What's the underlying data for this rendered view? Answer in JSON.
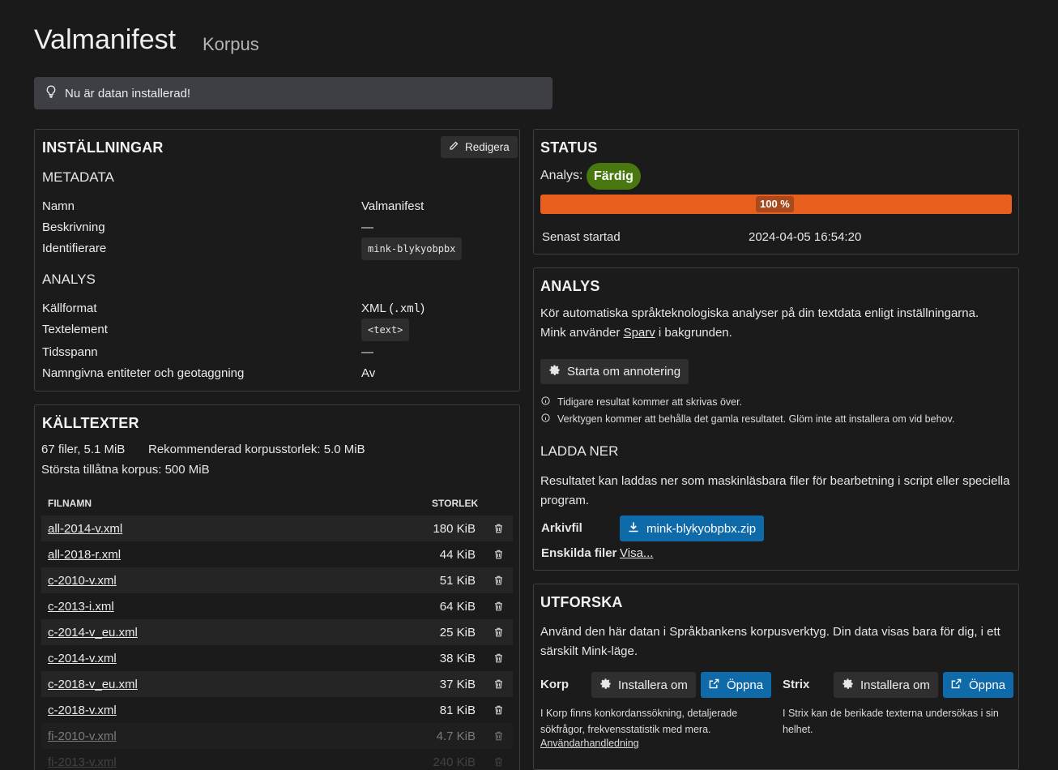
{
  "header": {
    "title": "Valmanifest",
    "subtitle": "Korpus"
  },
  "alert": {
    "text": "Nu är datan installerad!"
  },
  "settings": {
    "title": "INSTÄLLNINGAR",
    "edit_label": "Redigera",
    "metadata_title": "METADATA",
    "metadata": [
      {
        "label": "Namn",
        "value": "Valmanifest"
      },
      {
        "label": "Beskrivning",
        "value": "—"
      },
      {
        "label": "Identifierare",
        "value": "mink-blykyobpbx"
      }
    ],
    "analysis_title": "ANALYS",
    "analysis": [
      {
        "label": "Källformat",
        "value": "XML (",
        "value_code": ".xml",
        "value_suffix": ")"
      },
      {
        "label": "Textelement",
        "value": "<text>"
      },
      {
        "label": "Tidsspann",
        "value": "—"
      },
      {
        "label": "Namngivna entiteter och geotaggning",
        "value": "Av"
      }
    ]
  },
  "sources": {
    "title": "KÄLLTEXTER",
    "file_count": "67 filer, 5.1 MiB",
    "recommended": "Rekommenderad korpusstorlek: 5.0 MiB",
    "max": "Största tillåtna korpus: 500 MiB",
    "col_name": "FILNAMN",
    "col_size": "STORLEK",
    "files": [
      {
        "name": "all-2014-v.xml",
        "size": "180 KiB"
      },
      {
        "name": "all-2018-r.xml",
        "size": "44 KiB"
      },
      {
        "name": "c-2010-v.xml",
        "size": "51 KiB"
      },
      {
        "name": "c-2013-i.xml",
        "size": "64 KiB"
      },
      {
        "name": "c-2014-v_eu.xml",
        "size": "25 KiB"
      },
      {
        "name": "c-2014-v.xml",
        "size": "38 KiB"
      },
      {
        "name": "c-2018-v_eu.xml",
        "size": "37 KiB"
      },
      {
        "name": "c-2018-v.xml",
        "size": "81 KiB"
      },
      {
        "name": "fi-2010-v.xml",
        "size": "4.7 KiB"
      },
      {
        "name": "fi-2013-v.xml",
        "size": "240 KiB"
      }
    ]
  },
  "status": {
    "title": "STATUS",
    "analysis_label": "Analys:",
    "badge": "Färdig",
    "progress_percent": 100,
    "progress_label": "100 %",
    "last_started_label": "Senast startad",
    "last_started_value": "2024-04-05 16:54:20",
    "colors": {
      "progress": "#e95f1d",
      "badge": "#48780f"
    }
  },
  "analysis": {
    "title": "ANALYS",
    "description_1": "Kör automatiska språkteknologiska analyser på din textdata enligt inställningarna.",
    "description_2_prefix": "Mink använder ",
    "description_2_link": "Sparv",
    "description_2_suffix": " i bakgrunden.",
    "restart_label": "Starta om annotering",
    "note_1": "Tidigare resultat kommer att skrivas över.",
    "note_2": "Verktygen kommer att behålla det gamla resultatet. Glöm inte att installera om vid behov.",
    "download_title": "LADDA NER",
    "download_desc": "Resultatet kan laddas ner som maskinläsbara filer för bearbetning i script eller speciella program.",
    "archive_label": "Arkivfil",
    "archive_file": "mink-blykyobpbx.zip",
    "single_label": "Enskilda filer",
    "single_link": "Visa..."
  },
  "explore": {
    "title": "UTFORSKA",
    "description": "Använd den här datan i Språkbankens korpusverktyg. Din data visas bara för dig, i ett särskilt Mink-läge.",
    "korp": {
      "label": "Korp",
      "reinstall": "Installera om",
      "open": "Öppna",
      "desc": "I Korp finns konkordanssökning, detaljerade sökfrågor, frekvensstatistik med mera.",
      "manual": "Användarhandledning"
    },
    "strix": {
      "label": "Strix",
      "reinstall": "Installera om",
      "open": "Öppna",
      "desc": "I Strix kan de berikade texterna undersökas i sin helhet."
    }
  }
}
